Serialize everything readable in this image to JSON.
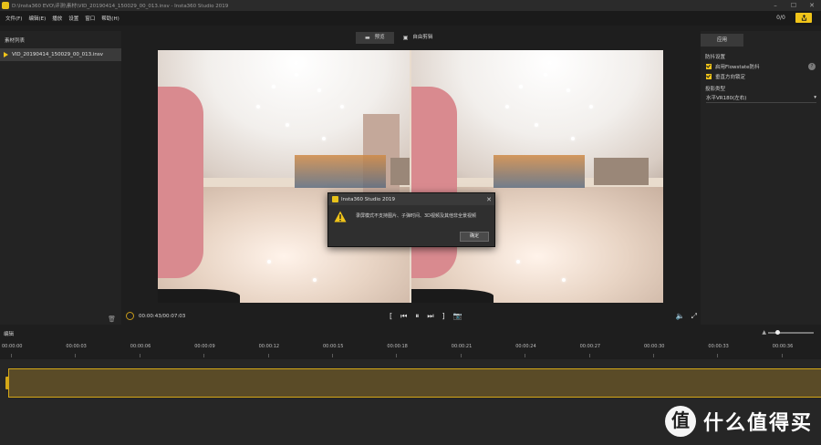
{
  "window": {
    "title": "D:\\Insta360 EVO\\评测\\素材\\VID_20190414_150029_00_013.insv - Insta360 Studio 2019",
    "controls": [
      "–",
      "☐",
      "✕"
    ]
  },
  "menu": {
    "items": [
      "文件(F)",
      "编辑(E)",
      "播放",
      "设置",
      "窗口",
      "帮助(H)"
    ],
    "counter": "0/0"
  },
  "left_panel": {
    "title": "素材列表",
    "files": [
      "VID_20190414_150029_00_013.insv"
    ]
  },
  "view_tabs": [
    {
      "label": "预览",
      "icon": "film-icon"
    },
    {
      "label": "自由剪辑",
      "icon": "clip-icon"
    }
  ],
  "dialog": {
    "title": "Insta360 Studio 2019",
    "message": "录屏模式不支持图片、子弹时间、3D视频及其他非全景视频",
    "ok_label": "确定"
  },
  "playback": {
    "timecode": "00:00:43/00:07:03",
    "controls": [
      "[",
      "⏮",
      "⏸",
      "⏭",
      "]"
    ]
  },
  "right_panel": {
    "apply_label": "应用",
    "stabilization_title": "防抖设置",
    "flowstate_label": "启用Flowstate防抖",
    "vertical_lock_label": "垂直方向锁定",
    "projection_title": "投影类型",
    "projection_value": "水平VR180(左右)"
  },
  "timeline": {
    "label": "编辑",
    "ticks": [
      "00:00:00",
      "00:00:03",
      "00:00:06",
      "00:00:09",
      "00:00:12",
      "00:00:15",
      "00:00:18",
      "00:00:21",
      "00:00:24",
      "00:00:27",
      "00:00:30",
      "00:00:33",
      "00:00:36"
    ]
  },
  "watermark": {
    "text": "什么值得买",
    "logo_glyph": "值"
  },
  "colors": {
    "accent": "#f0c419",
    "track_fill": "#5a4b27",
    "track_border": "#d4a717"
  }
}
